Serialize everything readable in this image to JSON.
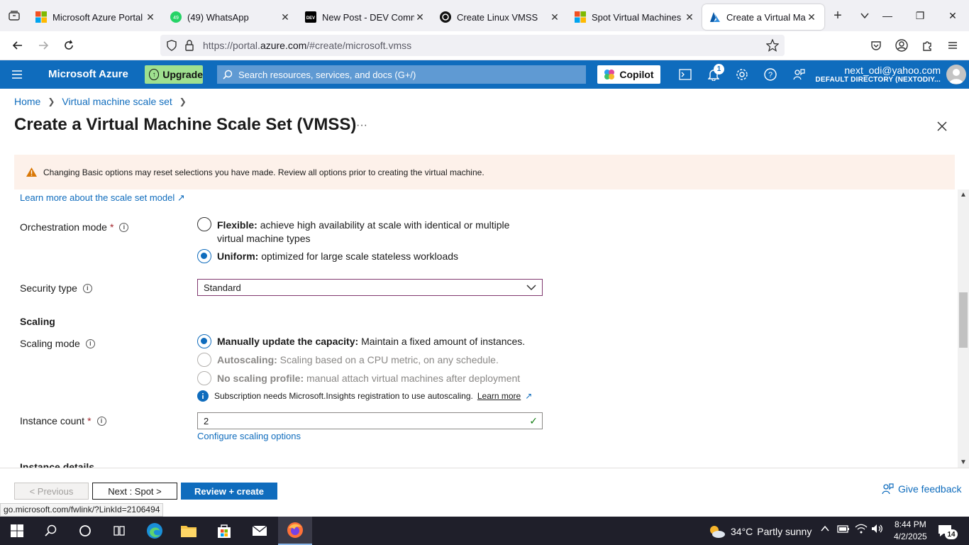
{
  "browser": {
    "tabs": [
      {
        "title": "Microsoft Azure Portal",
        "icon": "microsoft-logo-icon"
      },
      {
        "title": "(49) WhatsApp",
        "icon": "whatsapp-icon",
        "badge": "49"
      },
      {
        "title": "New Post - DEV Comm",
        "icon": "dev-logo-icon",
        "logo_text": "DEV"
      },
      {
        "title": "Create Linux VMSS",
        "icon": "chatgpt-icon"
      },
      {
        "title": "Spot Virtual Machines",
        "icon": "microsoft-logo-icon"
      },
      {
        "title": "Create a Virtual Machi",
        "icon": "azure-logo-icon",
        "active": true
      }
    ],
    "url_prefix": "https://portal.",
    "url_domain": "azure.com",
    "url_suffix": "/#create/microsoft.vmss",
    "status_url": "go.microsoft.com/fwlink/?LinkId=2106494"
  },
  "azure_header": {
    "brand": "Microsoft Azure",
    "upgrade_label": "Upgrade",
    "search_placeholder": "Search resources, services, and docs (G+/)",
    "copilot_label": "Copilot",
    "notification_count": "1",
    "account_email": "next_odi@yahoo.com",
    "account_directory": "DEFAULT DIRECTORY (NEXTODIY..."
  },
  "breadcrumb": {
    "home": "Home",
    "parent": "Virtual machine scale set"
  },
  "page": {
    "title": "Create a Virtual Machine Scale Set (VMSS)",
    "more": "···",
    "warning": "Changing Basic options may reset selections you have made. Review all options prior to creating the virtual machine."
  },
  "form": {
    "learn_more_link": "Learn more about the scale set model",
    "orchestration": {
      "label": "Orchestration mode",
      "required": "*",
      "options": [
        {
          "title": "Flexible:",
          "desc": "achieve high availability at scale with identical or multiple virtual machine types",
          "selected": false
        },
        {
          "title": "Uniform:",
          "desc": "optimized for large scale stateless workloads",
          "selected": true
        }
      ]
    },
    "security_type": {
      "label": "Security type",
      "value": "Standard"
    },
    "scaling": {
      "section_title": "Scaling",
      "label": "Scaling mode",
      "options": [
        {
          "title": "Manually update the capacity:",
          "desc": "Maintain a fixed amount of instances.",
          "selected": true,
          "disabled": false
        },
        {
          "title": "Autoscaling:",
          "desc": "Scaling based on a CPU metric, on any schedule.",
          "selected": false,
          "disabled": true
        },
        {
          "title": "No scaling profile:",
          "desc": "manual attach virtual machines after deployment",
          "selected": false,
          "disabled": true
        }
      ],
      "info_text": "Subscription needs Microsoft.Insights registration to use autoscaling.",
      "info_link": "Learn more"
    },
    "instance_count": {
      "label": "Instance count",
      "required": "*",
      "value": "2",
      "configure_link": "Configure scaling options"
    },
    "next_section_title": "Instance details"
  },
  "footer": {
    "previous": "< Previous",
    "next": "Next : Spot >",
    "review": "Review + create",
    "feedback": "Give feedback"
  },
  "taskbar": {
    "weather_temp": "34°C",
    "weather_text": "Partly sunny",
    "time": "8:44 PM",
    "date": "4/2/2025",
    "notification_count": "14"
  },
  "colors": {
    "azure_blue": "#0f6cbd",
    "upgrade_green": "#9fe08f",
    "warning_bg": "#fdf1ea",
    "select_border": "#80386f"
  }
}
